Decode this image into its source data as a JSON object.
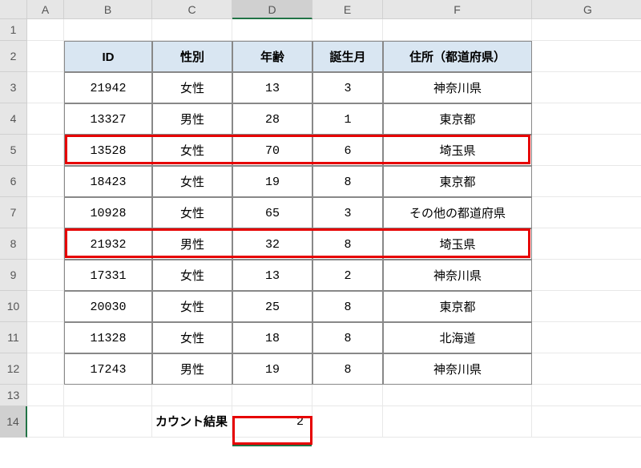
{
  "columns": [
    "A",
    "B",
    "C",
    "D",
    "E",
    "F",
    "G"
  ],
  "active_column": "D",
  "active_row": 14,
  "row_headers": [
    1,
    2,
    3,
    4,
    5,
    6,
    7,
    8,
    9,
    10,
    11,
    12,
    13,
    14
  ],
  "table": {
    "headers": {
      "id": "ID",
      "gender": "性別",
      "age": "年齢",
      "birth_month": "誕生月",
      "address": "住所（都道府県）"
    },
    "rows": [
      {
        "id": "21942",
        "gender": "女性",
        "age": "13",
        "birth_month": "3",
        "address": "神奈川県"
      },
      {
        "id": "13327",
        "gender": "男性",
        "age": "28",
        "birth_month": "1",
        "address": "東京都"
      },
      {
        "id": "13528",
        "gender": "女性",
        "age": "70",
        "birth_month": "6",
        "address": "埼玉県"
      },
      {
        "id": "18423",
        "gender": "女性",
        "age": "19",
        "birth_month": "8",
        "address": "東京都"
      },
      {
        "id": "10928",
        "gender": "女性",
        "age": "65",
        "birth_month": "3",
        "address": "その他の都道府県"
      },
      {
        "id": "21932",
        "gender": "男性",
        "age": "32",
        "birth_month": "8",
        "address": "埼玉県"
      },
      {
        "id": "17331",
        "gender": "女性",
        "age": "13",
        "birth_month": "2",
        "address": "神奈川県"
      },
      {
        "id": "20030",
        "gender": "女性",
        "age": "25",
        "birth_month": "8",
        "address": "東京都"
      },
      {
        "id": "11328",
        "gender": "女性",
        "age": "18",
        "birth_month": "8",
        "address": "北海道"
      },
      {
        "id": "17243",
        "gender": "男性",
        "age": "19",
        "birth_month": "8",
        "address": "神奈川県"
      }
    ]
  },
  "count": {
    "label": "カウント結果",
    "value": "2"
  },
  "chart_data": {
    "type": "table",
    "title": "",
    "columns": [
      "ID",
      "性別",
      "年齢",
      "誕生月",
      "住所（都道府県）"
    ],
    "rows": [
      [
        21942,
        "女性",
        13,
        3,
        "神奈川県"
      ],
      [
        13327,
        "男性",
        28,
        1,
        "東京都"
      ],
      [
        13528,
        "女性",
        70,
        6,
        "埼玉県"
      ],
      [
        18423,
        "女性",
        19,
        8,
        "東京都"
      ],
      [
        10928,
        "女性",
        65,
        3,
        "その他の都道府県"
      ],
      [
        21932,
        "男性",
        32,
        8,
        "埼玉県"
      ],
      [
        17331,
        "女性",
        13,
        2,
        "神奈川県"
      ],
      [
        20030,
        "女性",
        25,
        8,
        "東京都"
      ],
      [
        11328,
        "女性",
        18,
        8,
        "北海道"
      ],
      [
        17243,
        "男性",
        19,
        8,
        "神奈川県"
      ]
    ],
    "highlighted_rows_index": [
      2,
      5
    ],
    "count_result": 2
  }
}
